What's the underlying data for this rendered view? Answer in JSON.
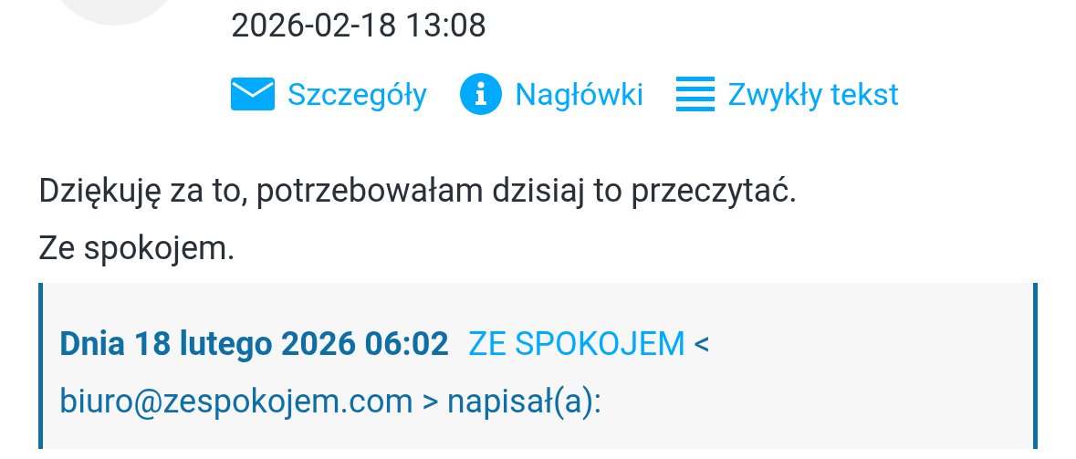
{
  "message": {
    "date": "2026-02-18 13:08",
    "links": [
      {
        "kind": "envelope",
        "label": "Szczegóły"
      },
      {
        "kind": "info",
        "label": "Nagłówki"
      },
      {
        "kind": "lines",
        "label": "Zwykły tekst"
      }
    ],
    "body": [
      "Dziękuję za to, potrzebowałam dzisiaj to przeczytać.",
      "Ze spokojem."
    ],
    "quote": {
      "intro": "Dnia 18 lutego 2026 06:02",
      "sender": "ZE SPOKOJEM",
      "rest": "< biuro@zespokojem.com > napisał(a):"
    }
  }
}
